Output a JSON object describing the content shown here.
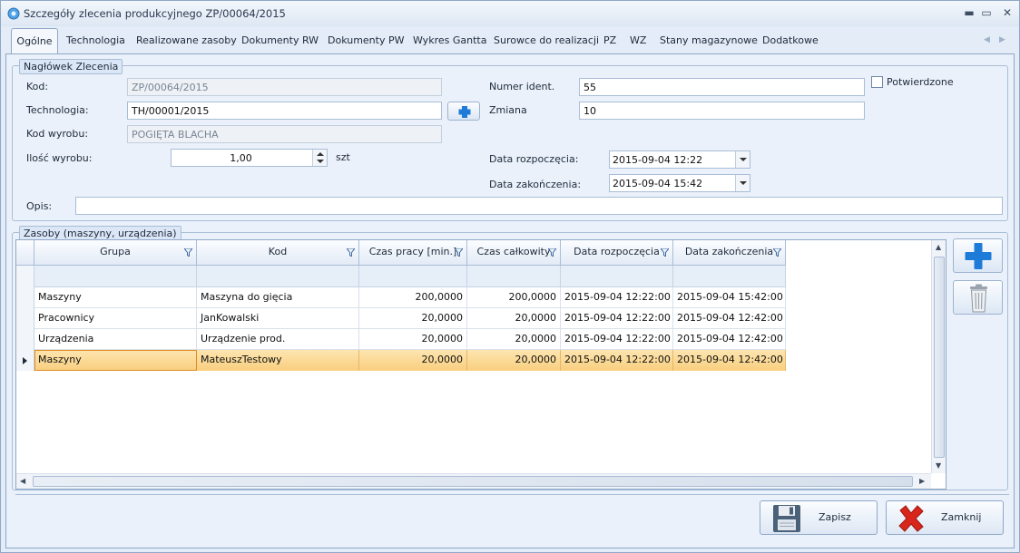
{
  "window": {
    "title": "Szczegóły zlecenia produkcyjnego ZP/00064/2015",
    "minimize": "▬",
    "maximize": "▭",
    "close": "✕"
  },
  "tabs": [
    {
      "label": "Ogólne",
      "active": true
    },
    {
      "label": "Technologia"
    },
    {
      "label": "Realizowane zasoby"
    },
    {
      "label": "Dokumenty RW"
    },
    {
      "label": "Dokumenty PW"
    },
    {
      "label": "Wykres Gantta"
    },
    {
      "label": "Surowce do realizacji"
    },
    {
      "label": "PZ"
    },
    {
      "label": "WZ"
    },
    {
      "label": "Stany magazynowe"
    },
    {
      "label": "Dodatkowe"
    }
  ],
  "tab_nav": {
    "prev": "◀",
    "next": "▶"
  },
  "header_group": {
    "legend": "Nagłówek Zlecenia",
    "kod_label": "Kod:",
    "kod_value": "ZP/00064/2015",
    "technologia_label": "Technologia:",
    "technologia_value": "TH/00001/2015",
    "kod_wyrobu_label": "Kod wyrobu:",
    "kod_wyrobu_value": "POGIĘTA BLACHA",
    "ilosc_label": "Ilość wyrobu:",
    "ilosc_value": "1,00",
    "ilosc_unit": "szt",
    "numer_ident_label": "Numer ident.",
    "numer_ident_value": "55",
    "zmiana_label": "Zmiana",
    "zmiana_value": "10",
    "potwierdzone_label": "Potwierdzone",
    "potwierdzone_checked": false,
    "data_rozp_label": "Data rozpoczęcia:",
    "data_rozp_value": "2015-09-04 12:22",
    "data_zak_label": "Data zakończenia:",
    "data_zak_value": "2015-09-04 15:42",
    "opis_label": "Opis:",
    "opis_value": ""
  },
  "resources_group": {
    "legend": "Zasoby (maszyny, urządzenia)",
    "columns": [
      "Grupa",
      "Kod",
      "Czas pracy [min.]",
      "Czas całkowity",
      "Data rozpoczęcia",
      "Data zakończenia"
    ],
    "rows": [
      [
        "Maszyny",
        "Maszyna do gięcia",
        "200,0000",
        "200,0000",
        "2015-09-04 12:22:00",
        "2015-09-04 15:42:00"
      ],
      [
        "Pracownicy",
        "JanKowalski",
        "20,0000",
        "20,0000",
        "2015-09-04 12:22:00",
        "2015-09-04 12:42:00"
      ],
      [
        "Urządzenia",
        "Urządzenie prod.",
        "20,0000",
        "20,0000",
        "2015-09-04 12:22:00",
        "2015-09-04 12:42:00"
      ],
      [
        "Maszyny",
        "MateuszTestowy",
        "20,0000",
        "20,0000",
        "2015-09-04 12:22:00",
        "2015-09-04 12:42:00"
      ]
    ],
    "selected_row": 3
  },
  "buttons": {
    "zapisz": "Zapisz",
    "zamknij": "Zamknij"
  },
  "colors": {
    "accent_blue": "#1f7bd8",
    "selection": "#fbd796",
    "close_red": "#d9261c"
  }
}
